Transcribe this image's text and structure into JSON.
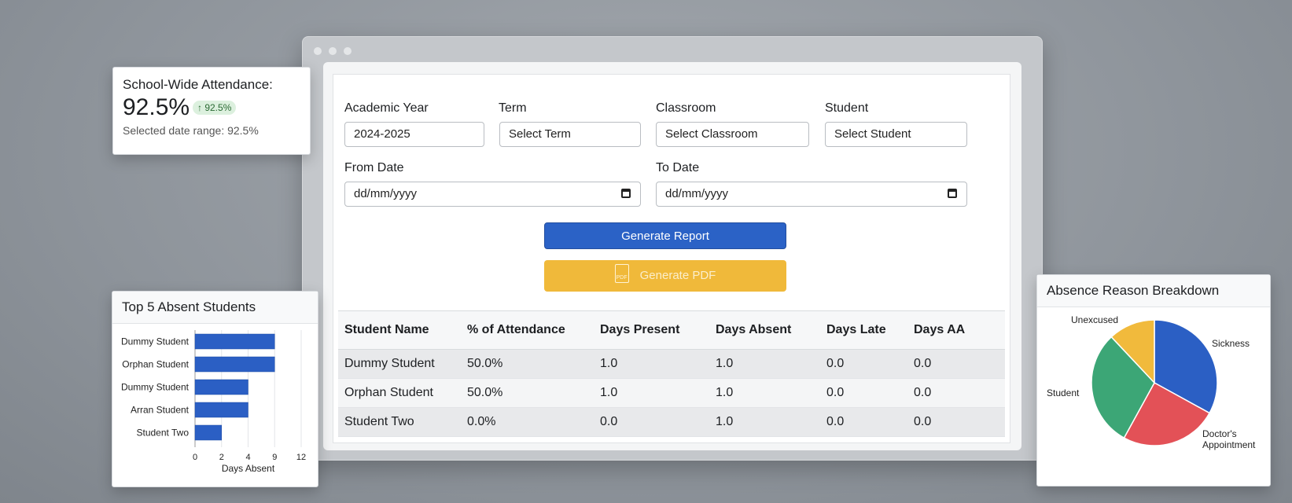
{
  "form": {
    "academic_year": {
      "label": "Academic Year",
      "value": "2024-2025"
    },
    "term": {
      "label": "Term",
      "placeholder": "Select Term"
    },
    "classroom": {
      "label": "Classroom",
      "placeholder": "Select Classroom"
    },
    "student": {
      "label": "Student",
      "placeholder": "Select Student"
    },
    "from_date": {
      "label": "From Date",
      "placeholder": "dd/mm/yyyy"
    },
    "to_date": {
      "label": "To Date",
      "placeholder": "dd/mm/yyyy"
    },
    "generate_report_label": "Generate Report",
    "generate_pdf_label": "Generate PDF",
    "pdf_icon_text": "PDF"
  },
  "table": {
    "headers": [
      "Student Name",
      "% of Attendance",
      "Days Present",
      "Days Absent",
      "Days Late",
      "Days AA"
    ],
    "rows": [
      [
        "Dummy Student",
        "50.0%",
        "1.0",
        "1.0",
        "0.0",
        "0.0"
      ],
      [
        "Orphan Student",
        "50.0%",
        "1.0",
        "1.0",
        "0.0",
        "0.0"
      ],
      [
        "Student Two",
        "0.0%",
        "0.0",
        "1.0",
        "0.0",
        "0.0"
      ]
    ]
  },
  "attendance_card": {
    "title": "School-Wide Attendance:",
    "value": "92.5%",
    "badge": "↑ 92.5%",
    "subtitle": "Selected date range: 92.5%"
  },
  "top5_card": {
    "title": "Top 5 Absent Students"
  },
  "absence_card": {
    "title": "Absence Reason Breakdown"
  },
  "colors": {
    "primary": "#2b62c6",
    "pdf": "#f0b93a",
    "green": "#3aa575",
    "red": "#e05054",
    "yellow": "#f0b93a"
  },
  "chart_data": [
    {
      "type": "bar",
      "orientation": "horizontal",
      "categories": [
        "Dummy Student",
        "Orphan Student",
        "Dummy Student",
        "Arran Student",
        "Student Two"
      ],
      "values": [
        6,
        6,
        4,
        4,
        2
      ],
      "xlabel": "Days Absent",
      "ticks": [
        "0",
        "2",
        "4",
        "9",
        "12"
      ],
      "xlim": [
        0,
        8
      ],
      "grid": true
    },
    {
      "type": "pie",
      "labels": [
        "Sickness",
        "Doctor's Appointment",
        "Student",
        "Unexcused"
      ],
      "values": [
        33,
        25,
        30,
        12
      ],
      "colors": [
        "#2b5fc4",
        "#e35157",
        "#3ca676",
        "#f1ba3c"
      ]
    }
  ]
}
